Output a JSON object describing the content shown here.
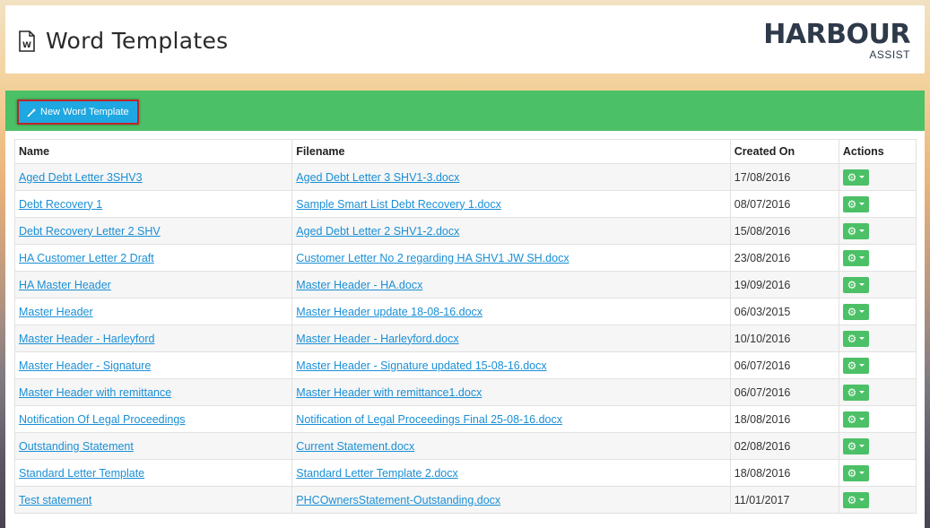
{
  "header": {
    "title": "Word Templates",
    "page_icon": "word-document-icon",
    "logo": {
      "main": "HARBOUR",
      "sub": "ASSIST"
    }
  },
  "toolbar": {
    "new_label": "New Word Template",
    "new_icon": "magic-wand-icon"
  },
  "table": {
    "columns": [
      "Name",
      "Filename",
      "Created On",
      "Actions"
    ],
    "rows": [
      {
        "name": "Aged Debt Letter 3SHV3",
        "filename": "Aged Debt Letter 3 SHV1-3.docx",
        "created": "17/08/2016"
      },
      {
        "name": "Debt Recovery 1",
        "filename": "Sample Smart List Debt Recovery 1.docx",
        "created": "08/07/2016"
      },
      {
        "name": "Debt Recovery Letter 2 SHV",
        "filename": "Aged Debt Letter 2 SHV1-2.docx",
        "created": "15/08/2016"
      },
      {
        "name": "HA Customer Letter 2 Draft",
        "filename": "Customer Letter No 2 regarding HA SHV1 JW SH.docx",
        "created": "23/08/2016"
      },
      {
        "name": "HA Master Header",
        "filename": "Master Header - HA.docx",
        "created": "19/09/2016"
      },
      {
        "name": "Master Header",
        "filename": "Master Header update 18-08-16.docx",
        "created": "06/03/2015"
      },
      {
        "name": "Master Header - Harleyford",
        "filename": "Master Header - Harleyford.docx",
        "created": "10/10/2016"
      },
      {
        "name": "Master Header - Signature",
        "filename": "Master Header - Signature updated 15-08-16.docx",
        "created": "06/07/2016"
      },
      {
        "name": "Master Header with remittance",
        "filename": "Master Header with remittance1.docx",
        "created": "06/07/2016"
      },
      {
        "name": "Notification Of Legal Proceedings",
        "filename": "Notification of Legal Proceedings Final 25-08-16.docx",
        "created": "18/08/2016"
      },
      {
        "name": "Outstanding Statement",
        "filename": "Current Statement.docx",
        "created": "02/08/2016"
      },
      {
        "name": "Standard Letter Template",
        "filename": "Standard Letter Template 2.docx",
        "created": "18/08/2016"
      },
      {
        "name": "Test statement",
        "filename": "PHCOwnersStatement-Outstanding.docx",
        "created": "11/01/2017"
      }
    ],
    "action_icon": "gear-icon"
  },
  "colors": {
    "toolbar_green": "#4cc066",
    "button_blue": "#1ea7e1",
    "highlight_red": "#c0242a",
    "link_blue": "#1a8fd6"
  }
}
